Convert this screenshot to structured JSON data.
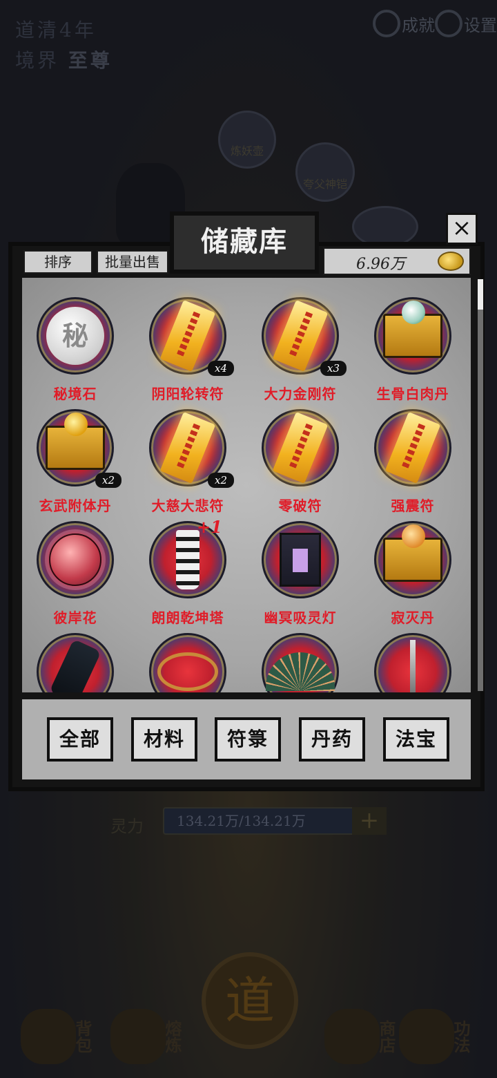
{
  "background": {
    "status_line1": "道清4年",
    "realm_label": "境界",
    "realm_value": "至尊",
    "achievements_label": "成就",
    "settings_label": "设置",
    "orb1_label": "炼妖壶",
    "orb2_label": "夸父神铠",
    "lingli_label": "灵力",
    "lingli_value": "134.21万/134.21万",
    "dao_char": "道",
    "nav": [
      {
        "label": "背包",
        "icon": "bag-icon"
      },
      {
        "label": "熔炼",
        "icon": "furnace-icon"
      },
      {
        "label": "商店",
        "icon": "scroll-icon"
      },
      {
        "label": "功法",
        "icon": "book-icon"
      }
    ]
  },
  "dialog": {
    "title": "储藏库",
    "close": "×",
    "sort_label": "排序",
    "batch_sell_label": "批量出售",
    "coins": "6.96万",
    "items": [
      {
        "name": "秘境石",
        "art": "stone",
        "art_text": "秘",
        "badge": ""
      },
      {
        "name": "阴阳轮转符",
        "art": "talisman",
        "badge": "x4"
      },
      {
        "name": "大力金刚符",
        "art": "talisman",
        "badge": "x3"
      },
      {
        "name": "生骨白肉丹",
        "art": "chest-pearl",
        "badge": ""
      },
      {
        "name": "玄武附体丹",
        "art": "chest-gold",
        "badge": "x2"
      },
      {
        "name": "大慈大悲符",
        "art": "talisman",
        "badge": "x2"
      },
      {
        "name": "零破符",
        "art": "talisman",
        "badge": ""
      },
      {
        "name": "强震符",
        "art": "talisman",
        "badge": ""
      },
      {
        "name": "彼岸花",
        "art": "ball",
        "badge": ""
      },
      {
        "name": "朗朗乾坤塔",
        "art": "pagoda",
        "badge": "",
        "plus": "+1"
      },
      {
        "name": "幽冥吸灵灯",
        "art": "lantern",
        "badge": ""
      },
      {
        "name": "寂灭丹",
        "art": "chest-amber",
        "badge": ""
      },
      {
        "name": "",
        "art": "glove",
        "badge": ""
      },
      {
        "name": "",
        "art": "ring",
        "badge": ""
      },
      {
        "name": "",
        "art": "fan",
        "badge": ""
      },
      {
        "name": "",
        "art": "sword",
        "badge": ""
      }
    ],
    "categories": [
      "全部",
      "材料",
      "符箓",
      "丹药",
      "法宝"
    ]
  }
}
